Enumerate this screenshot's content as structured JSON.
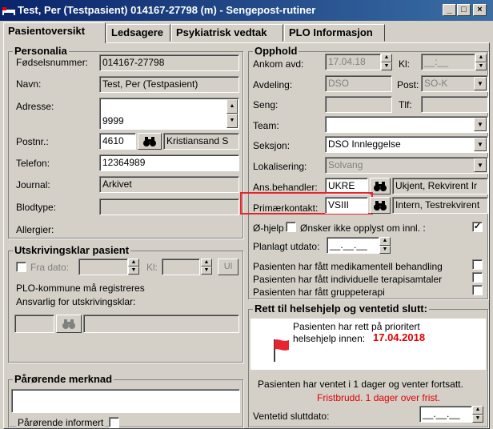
{
  "window": {
    "title": "Test, Per (Testpasient)  014167-27798 (m) - Sengepost-rutiner"
  },
  "tabs": [
    {
      "label": "Pasientoversikt"
    },
    {
      "label": "Ledsagere"
    },
    {
      "label": "Psykiatrisk vedtak"
    },
    {
      "label": "PLO Informasjon"
    }
  ],
  "personalia": {
    "title": "Personalia",
    "fodselsnummer_label": "Fødselsnummer:",
    "fodselsnummer": "014167-27798",
    "navn_label": "Navn:",
    "navn": "Test, Per (Testpasient)",
    "adresse_label": "Adresse:",
    "adresse": "9999",
    "postnr_label": "Postnr.:",
    "postnr": "4610",
    "poststed": "Kristiansand S",
    "telefon_label": "Telefon:",
    "telefon": "12364989",
    "journal_label": "Journal:",
    "journal": "Arkivet",
    "blodtype_label": "Blodtype:",
    "blodtype": "",
    "allergier_label": "Allergier:"
  },
  "utskriving": {
    "title": "Utskrivingsklar pasient",
    "fra_dato_label": "Fra dato:",
    "kl_label": "Kl:",
    "ul_label": "Ul",
    "plo_msg": "PLO-kommune må registreres",
    "ansvarlig_label": "Ansvarlig for utskrivingsklar:"
  },
  "parorende": {
    "title": "Pårørende merknad",
    "informert_label": "Pårørende informert"
  },
  "opphold": {
    "title": "Opphold",
    "ankom_label": "Ankom avd:",
    "ankom": "17.04.18",
    "kl_label": "Kl:",
    "kl": "__:__",
    "avdeling_label": "Avdeling:",
    "avdeling": "DSO",
    "post_label": "Post:",
    "post": "SO-K",
    "seng_label": "Seng:",
    "tlf_label": "Tlf:",
    "team_label": "Team:",
    "team": "",
    "seksjon_label": "Seksjon:",
    "seksjon": "DSO Innleggelse",
    "lokalisering_label": "Lokalisering:",
    "lokalisering": "Solvang",
    "ansbeh_label": "Ans.behandler:",
    "ansbeh_code": "UKRE",
    "ansbeh_name": "Ukjent, Rekvirent Ir",
    "primaer_label": "Primærkontakt:",
    "primaer_code": "VSIII",
    "primaer_name": "Intern, Testrekvirent",
    "ohjelp_label": "Ø-hjelp",
    "onsker_label": "Ønsker ikke opplyst om innl. :",
    "utdato_label": "Planlagt utdato:",
    "utdato": "__.__.__",
    "check1": "Pasienten har fått medikamentell behandling",
    "check2": "Pasienten har fått individuelle terapisamtaler",
    "check3": "Pasienten har fått gruppeterapi"
  },
  "rett": {
    "title": "Rett til helsehjelp og ventetid slutt:",
    "line1": "Pasienten har rett på prioritert",
    "line2": "helsehjelp innen:",
    "date": "17.04.2018",
    "venter": "Pasienten har ventet i 1 dager og venter fortsatt.",
    "fristbrudd": "Fristbrudd. 1 dager over frist.",
    "ventetid_label": "Ventetid sluttdato:",
    "ventetid": "__.__.__"
  },
  "colors": {
    "highlight": "#e8252e",
    "deadline": "#e00000"
  }
}
